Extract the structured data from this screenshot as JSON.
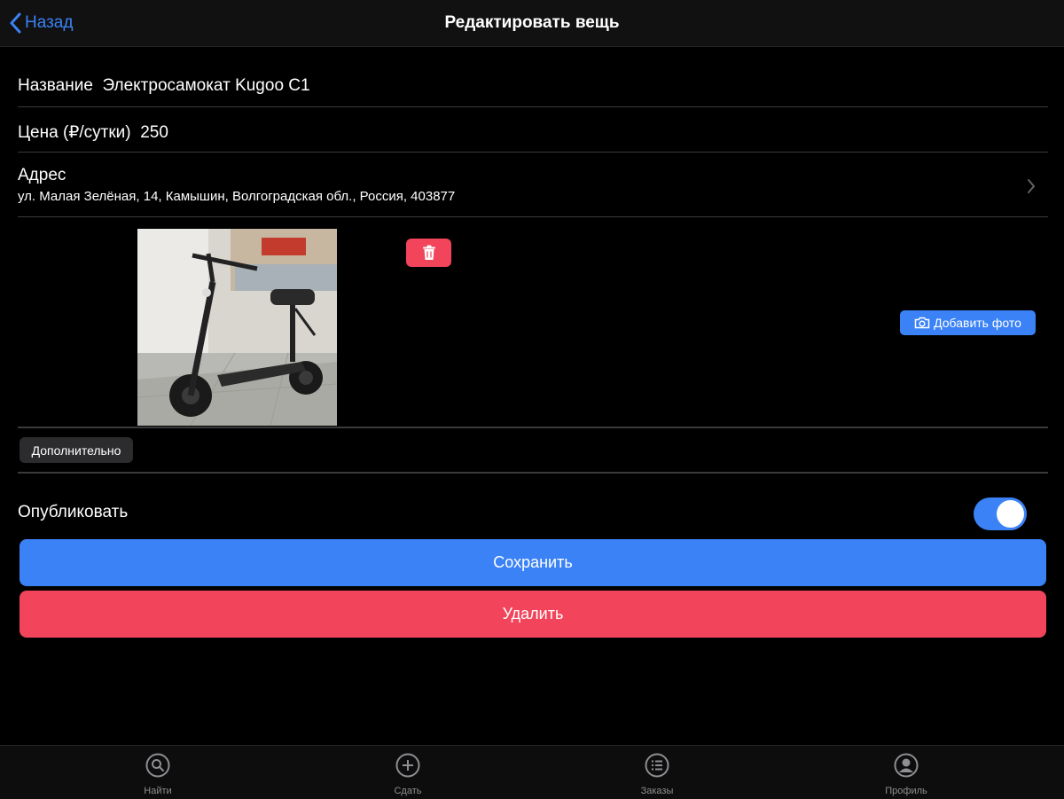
{
  "nav": {
    "back_label": "Назад",
    "title": "Редактировать вещь"
  },
  "form": {
    "name_label": "Название",
    "name_value": "Электросамокат Kugoo C1",
    "price_label": "Цена (₽/сутки)",
    "price_value": "250",
    "address_label": "Адрес",
    "address_value": "ул. Малая Зелёная, 14, Камышин, Волгоградская обл., Россия, 403877"
  },
  "photos": {
    "add_label": "Добавить фото"
  },
  "extra_label": "Дополнительно",
  "publish": {
    "label": "Опубликовать",
    "enabled": true
  },
  "actions": {
    "save_label": "Сохранить",
    "delete_label": "Удалить"
  },
  "tabs": [
    {
      "label": "Найти",
      "icon": "search-icon"
    },
    {
      "label": "Сдать",
      "icon": "plus-circle-icon"
    },
    {
      "label": "Заказы",
      "icon": "list-icon"
    },
    {
      "label": "Профиль",
      "icon": "profile-icon"
    }
  ],
  "colors": {
    "accent": "#3b82f6",
    "danger": "#f2445a",
    "background": "#000000"
  }
}
